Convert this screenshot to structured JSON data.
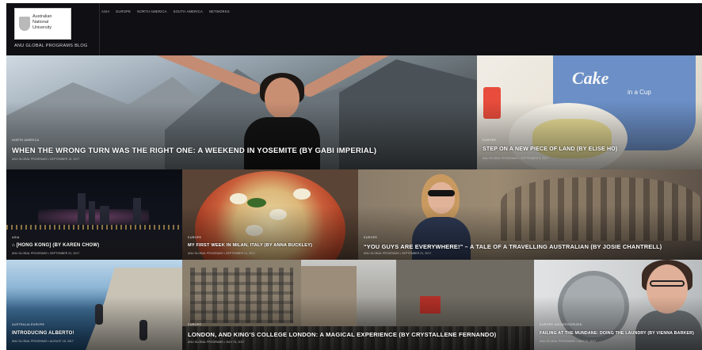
{
  "header": {
    "logo": {
      "line1": "Australian",
      "line2": "National",
      "line3": "University"
    },
    "blog_title": "ANU GLOBAL PROGRAMS BLOG",
    "nav": [
      "ASIA",
      "EUROPE",
      "NORTH AMERICA",
      "SOUTH AMERICA",
      "NETWORKS"
    ]
  },
  "posts": [
    {
      "category": "NORTH AMERICA",
      "title": "WHEN THE WRONG TURN WAS THE RIGHT ONE: A WEEKEND IN YOSEMITE (BY GABI IMPERIAL)",
      "meta": "ANU GLOBAL PROGRAMS • SEPTEMBER 15, 2017"
    },
    {
      "category": "EUROPE",
      "title": "STEP ON A NEW PIECE OF LAND (BY ELISE HO)",
      "meta": "ANU GLOBAL PROGRAMS • SEPTEMBER 8, 2017"
    },
    {
      "category": "ASIA",
      "title": "⌂ [HONG KONG] (BY KAREN CHOW)",
      "meta": "ANU GLOBAL PROGRAMS • SEPTEMBER 22, 2017"
    },
    {
      "category": "EUROPE",
      "title": "MY FIRST WEEK IN MILAN, ITALY (BY ANNA BUCKLEY)",
      "meta": "ANU GLOBAL PROGRAMS • SEPTEMBER 21, 2017"
    },
    {
      "category": "EUROPE",
      "title": "\"YOU GUYS ARE EVERYWHERE!\" – A TALE OF A TRAVELLING AUSTRALIAN (BY JOSIE CHANTRELL)",
      "meta": "ANU GLOBAL PROGRAMS • SEPTEMBER 21, 2017"
    },
    {
      "category": "AUSTRALIA  EUROPE",
      "title": "INTRODUCING ALBERTO!",
      "meta": "ANU GLOBAL PROGRAMS • AUGUST 18, 2017"
    },
    {
      "category": "EUROPE",
      "title": "LONDON, AND KING'S COLLEGE LONDON: A MAGICAL EXPERIENCE (BY CRYSTALLENE FERNANDO)",
      "meta": "ANU GLOBAL PROGRAMS • JULY 31, 2017"
    },
    {
      "category": "EUROPE  UNCATEGORIZED",
      "title": "FAILING AT THE MUNDANE: DOING THE LAUNDRY (BY VIENNA BARKER)",
      "meta": "ANU GLOBAL PROGRAMS • JULY 21, 2017"
    }
  ],
  "colors": {
    "header_bg": "#0f0f14",
    "title_text": "#ffffff",
    "meta_text": "#bdbdbd"
  }
}
